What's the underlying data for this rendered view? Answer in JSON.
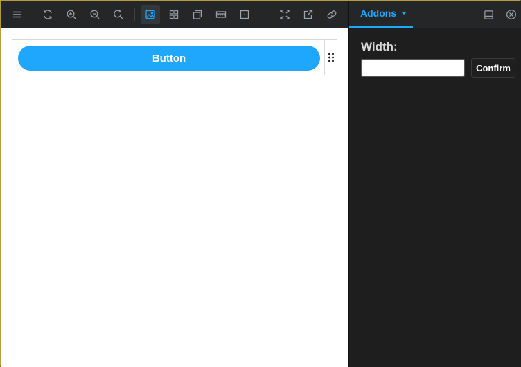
{
  "colors": {
    "accent": "#1ea7fd",
    "toolbar_bg": "#242628",
    "icon": "#9ba1a6",
    "panel_bg": "#1e1e1e",
    "canvas_bg": "#ffffff"
  },
  "toolbar": {
    "items": [
      {
        "icon": "menu-icon"
      },
      {
        "icon": "reload-icon"
      },
      {
        "icon": "zoom-in-icon"
      },
      {
        "icon": "zoom-out-icon"
      },
      {
        "icon": "zoom-reset-icon"
      },
      {
        "icon": "background-image-icon",
        "active": true
      },
      {
        "icon": "grid-icon"
      },
      {
        "icon": "viewport-icon"
      },
      {
        "icon": "measure-icon"
      },
      {
        "icon": "outline-icon"
      },
      {
        "icon": "fullscreen-icon"
      },
      {
        "icon": "open-new-tab-icon"
      },
      {
        "icon": "copy-link-icon"
      }
    ]
  },
  "preview": {
    "button_label": "Button"
  },
  "panel": {
    "tab_label": "Addons",
    "width_label": "Width:",
    "width_value": "",
    "confirm_label": "Confirm"
  }
}
